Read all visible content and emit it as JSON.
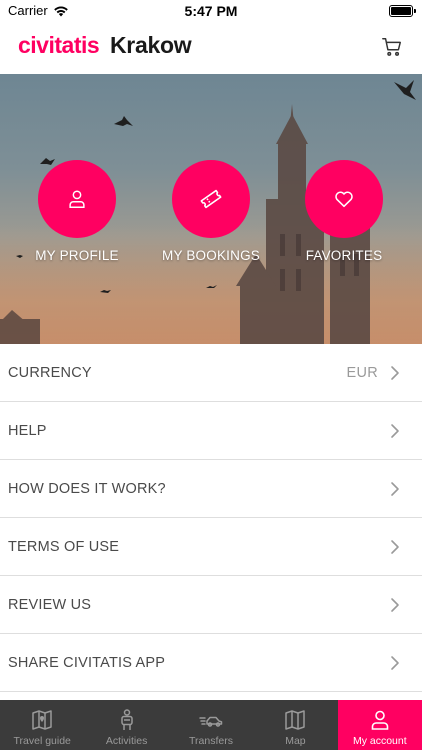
{
  "status": {
    "carrier": "Carrier",
    "time": "5:47 PM"
  },
  "header": {
    "brand": "civitatis",
    "city": "Krakow",
    "cart_icon": "cart-icon"
  },
  "colors": {
    "accent": "#ff0061",
    "tabbar_bg": "#3b3b3b",
    "divider": "#dedede"
  },
  "hero": {
    "actions": [
      {
        "label": "MY PROFILE",
        "icon": "user-icon"
      },
      {
        "label": "MY BOOKINGS",
        "icon": "ticket-icon"
      },
      {
        "label": "FAVORITES",
        "icon": "heart-icon"
      }
    ]
  },
  "menu": {
    "items": [
      {
        "label": "CURRENCY",
        "value": "EUR"
      },
      {
        "label": "HELP"
      },
      {
        "label": "HOW DOES IT WORK?"
      },
      {
        "label": "TERMS OF USE"
      },
      {
        "label": "REVIEW US"
      },
      {
        "label": "SHARE CIVITATIS APP"
      }
    ]
  },
  "tabbar": {
    "tabs": [
      {
        "label": "Travel guide",
        "icon": "map-book-icon",
        "active": false
      },
      {
        "label": "Activities",
        "icon": "person-activity-icon",
        "active": false
      },
      {
        "label": "Transfers",
        "icon": "car-icon",
        "active": false
      },
      {
        "label": "Map",
        "icon": "map-icon",
        "active": false
      },
      {
        "label": "My account",
        "icon": "user-icon",
        "active": true
      }
    ]
  }
}
